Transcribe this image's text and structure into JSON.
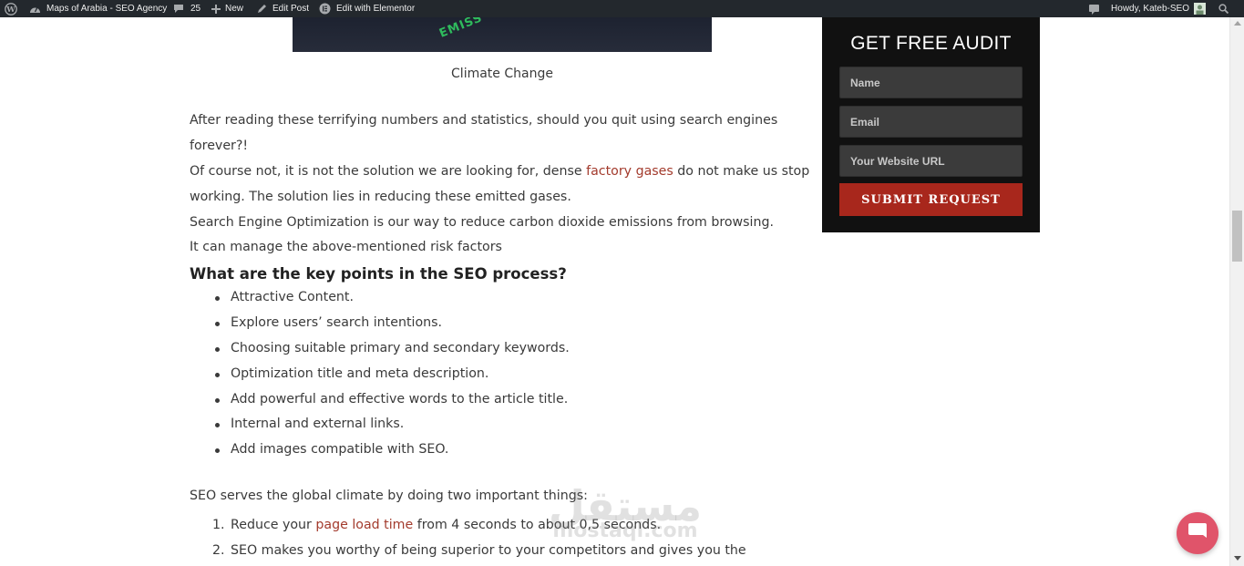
{
  "adminbar": {
    "site_name": "Maps of Arabia - SEO Agency",
    "comments_count": "25",
    "new_label": "New",
    "edit_post_label": "Edit Post",
    "elementor_label": "Edit with Elementor",
    "howdy_label": "Howdy, Kateb-SEO"
  },
  "article": {
    "image_overlay_text": "EMISS",
    "image_caption": "Climate Change",
    "para1": "After reading these terrifying numbers and statistics, should you quit using search engines forever?!",
    "para2_before": "Of course not, it is not the solution we are looking for, dense ",
    "para2_link": "factory gases",
    "para2_after": " do not make us stop working. The solution lies in reducing these emitted gases.",
    "para3": "Search Engine Optimization is our way to reduce carbon dioxide emissions from browsing.",
    "para4": "It can manage the above-mentioned risk factors",
    "heading": "What are the key points in the SEO process?",
    "bullets": [
      "Attractive Content.",
      "Explore users’ search intentions.",
      "Choosing suitable primary and secondary keywords.",
      "Optimization title and meta description.",
      "Add powerful and effective words to the article title.",
      "Internal and external links.",
      "Add images compatible with SEO."
    ],
    "para5": "SEO serves the global climate by doing two important things:",
    "ordered": [
      {
        "num": "1.",
        "before": "Reduce your ",
        "link": "page load time",
        "after": " from 4 seconds to about 0,5 seconds."
      },
      {
        "num": "2.",
        "before": "SEO makes you worthy of being superior to your competitors and gives you the",
        "link": "",
        "after": ""
      }
    ]
  },
  "watermark": {
    "top": "مستقل",
    "bottom": "mostaql.com"
  },
  "audit_form": {
    "title": "GET FREE AUDIT",
    "name_placeholder": "Name",
    "email_placeholder": "Email",
    "url_placeholder": "Your Website URL",
    "submit_label": "SUBMIT REQUEST"
  },
  "colors": {
    "adminbar_bg": "#23282d",
    "link": "#a33b2d",
    "audit_bg": "#111111",
    "submit_bg": "#a8271c",
    "chat_bg": "#e0546a"
  }
}
